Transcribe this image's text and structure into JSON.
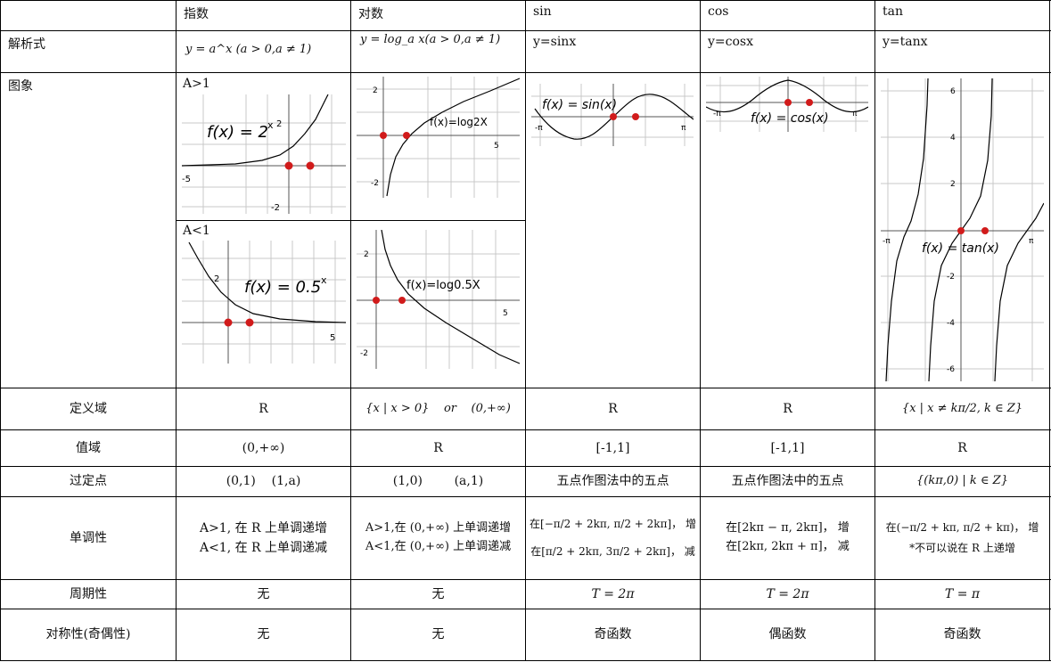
{
  "headers": {
    "col0": "",
    "col1": "指数",
    "col2": "对数",
    "col3": "sin",
    "col4": "cos",
    "col5": "tan"
  },
  "rows": {
    "formula": {
      "label": "解析式",
      "c1": "y = a^x (a > 0,a ≠ 1)",
      "c2": "y = log_a x(a > 0,a ≠ 1)",
      "c3": "y=sinx",
      "c4": "y=cosx",
      "c5": "y=tanx"
    },
    "graph": {
      "label": "图象",
      "exp_gt1": "A>1",
      "exp_lt1": "A<1"
    },
    "domain": {
      "label": "定义域",
      "c1": "R",
      "c2": "{x | x > 0}    or    (0,+∞)",
      "c3": "R",
      "c4": "R",
      "c5": "{x | x ≠ kπ/2, k ∈ Z}"
    },
    "range": {
      "label": "值域",
      "c1": "(0,+∞)",
      "c2": "R",
      "c3": "[-1,1]",
      "c4": "[-1,1]",
      "c5": "R"
    },
    "fixed_point": {
      "label": "过定点",
      "c1": "(0,1)    (1,a)",
      "c2": "(1,0)        (a,1)",
      "c3": "五点作图法中的五点",
      "c4": "五点作图法中的五点",
      "c5": "{(kπ,0) | k ∈ Z}"
    },
    "monotonic": {
      "label": "单调性",
      "c1a": "A>1, 在 R 上单调递增",
      "c1b": "A<1, 在 R 上单调递减",
      "c2a": "A>1,在 (0,+∞) 上单调递增",
      "c2b": "A<1,在 (0,+∞) 上单调递减",
      "c3a": "在[−π/2 + 2kπ, π/2 + 2kπ]， 增",
      "c3b": "在[π/2 + 2kπ, 3π/2 + 2kπ]， 减",
      "c4a": "在[2kπ − π, 2kπ]， 增",
      "c4b": "在[2kπ, 2kπ + π]， 减",
      "c5a": "在(−π/2 + kπ, π/2 + kπ)， 增",
      "c5b": "*不可以说在 R 上递增"
    },
    "period": {
      "label": "周期性",
      "c1": "无",
      "c2": "无",
      "c3": "T = 2π",
      "c4": "T = 2π",
      "c5": "T = π"
    },
    "symmetry": {
      "label": "对称性(奇偶性)",
      "c1": "无",
      "c2": "无",
      "c3": "奇函数",
      "c4": "偶函数",
      "c5": "奇函数"
    }
  },
  "plots": {
    "exp2": {
      "label_f": "f(x) = 2",
      "label_sup": "x",
      "ticks": [
        "2",
        "-5",
        "-2"
      ]
    },
    "exp05": {
      "label_f": "f(x) = 0.5",
      "label_sup": "x",
      "ticks": [
        "2",
        "5"
      ]
    },
    "log2": {
      "label": "f(x)=log2X",
      "ticks": [
        "2",
        "5",
        "-2"
      ]
    },
    "log05": {
      "label": "f(x)=log0.5X",
      "ticks": [
        "2",
        "5",
        "-2"
      ]
    },
    "sin": {
      "label": "f(x) = sin(x)",
      "ticks": [
        "-π",
        "π"
      ]
    },
    "cos": {
      "label": "f(x) = cos(x)",
      "ticks": [
        "-π",
        "π"
      ]
    },
    "tan": {
      "label": "f(x) = tan(x)",
      "ticks": [
        "6",
        "4",
        "2",
        "-2",
        "-4",
        "-6",
        "-π",
        "π"
      ]
    }
  },
  "colors": {
    "curve": "#000000",
    "grid": "#c8c8c8",
    "point": "#d11b1b",
    "border": "#000000"
  }
}
